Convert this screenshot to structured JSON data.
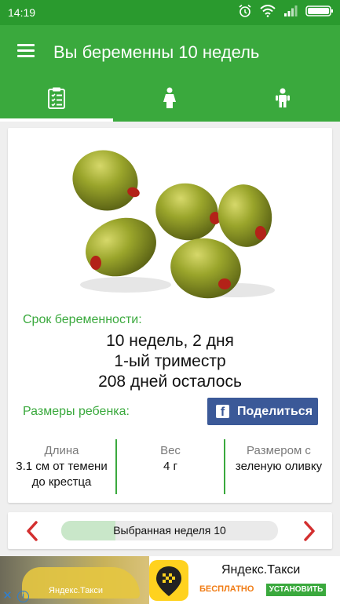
{
  "status_bar": {
    "time": "14:19"
  },
  "app_bar": {
    "title": "Вы беременны 10 недель"
  },
  "tabs": [
    {
      "name": "calendar-clipboard"
    },
    {
      "name": "mother"
    },
    {
      "name": "baby"
    }
  ],
  "pregnancy": {
    "term_label": "Срок беременности:",
    "term": "10 недель, 2 дня",
    "trimester": "1-ый триместр",
    "days_left": "208 дней осталось"
  },
  "baby": {
    "size_label": "Размеры ребенка:",
    "share_label": "Поделиться",
    "length_title": "Длина",
    "length_value_line1": "3.1 см от темени",
    "length_value_line2": "до крестца",
    "weight_title": "Вес",
    "weight_value": "4 г",
    "compare_title": "Размером с",
    "compare_value": "зеленую оливку"
  },
  "week_selector": {
    "label": "Выбранная неделя 10",
    "progress_fraction": 0.25
  },
  "ad": {
    "image_text": "Яндекс.Такси",
    "title": "Яндекс.Такси",
    "free_label": "БЕСПЛАТНО",
    "install_label": "УСТАНОВИТЬ"
  },
  "colors": {
    "primary": "#3aa93d",
    "status_bar": "#2a9a2e",
    "facebook": "#3b5998",
    "arrow": "#d32f2f"
  }
}
